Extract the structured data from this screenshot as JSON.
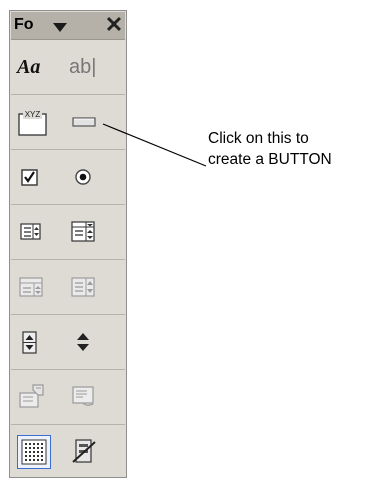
{
  "toolbox": {
    "title": "Fo",
    "rows": [
      {
        "left_icon": "label-icon",
        "right_icon": "textbox-icon",
        "left_text": "Aa",
        "right_text": "ab|"
      },
      {
        "left_icon": "option-group-icon",
        "right_icon": "command-button-icon",
        "left_text": "XYZ"
      },
      {
        "left_icon": "checkbox-icon",
        "right_icon": "option-button-icon"
      },
      {
        "left_icon": "list-box-icon",
        "right_icon": "combo-box-icon"
      },
      {
        "left_icon": "list-control-disabled-icon",
        "right_icon": "combo-control-disabled-icon"
      },
      {
        "left_icon": "spin-button-icon",
        "right_icon": "scroll-bar-icon"
      },
      {
        "left_icon": "properties-icon",
        "right_icon": "edit-code-icon"
      },
      {
        "left_icon": "toggle-grid-icon",
        "right_icon": "run-dialog-icon"
      }
    ]
  },
  "callout": {
    "line1": "Click on this to",
    "line2": "create a BUTTON"
  },
  "colors": {
    "toolbox_bg": "#dedbd5",
    "title_bg": "#b5b1a8",
    "selected_border": "#3a6ed0"
  }
}
